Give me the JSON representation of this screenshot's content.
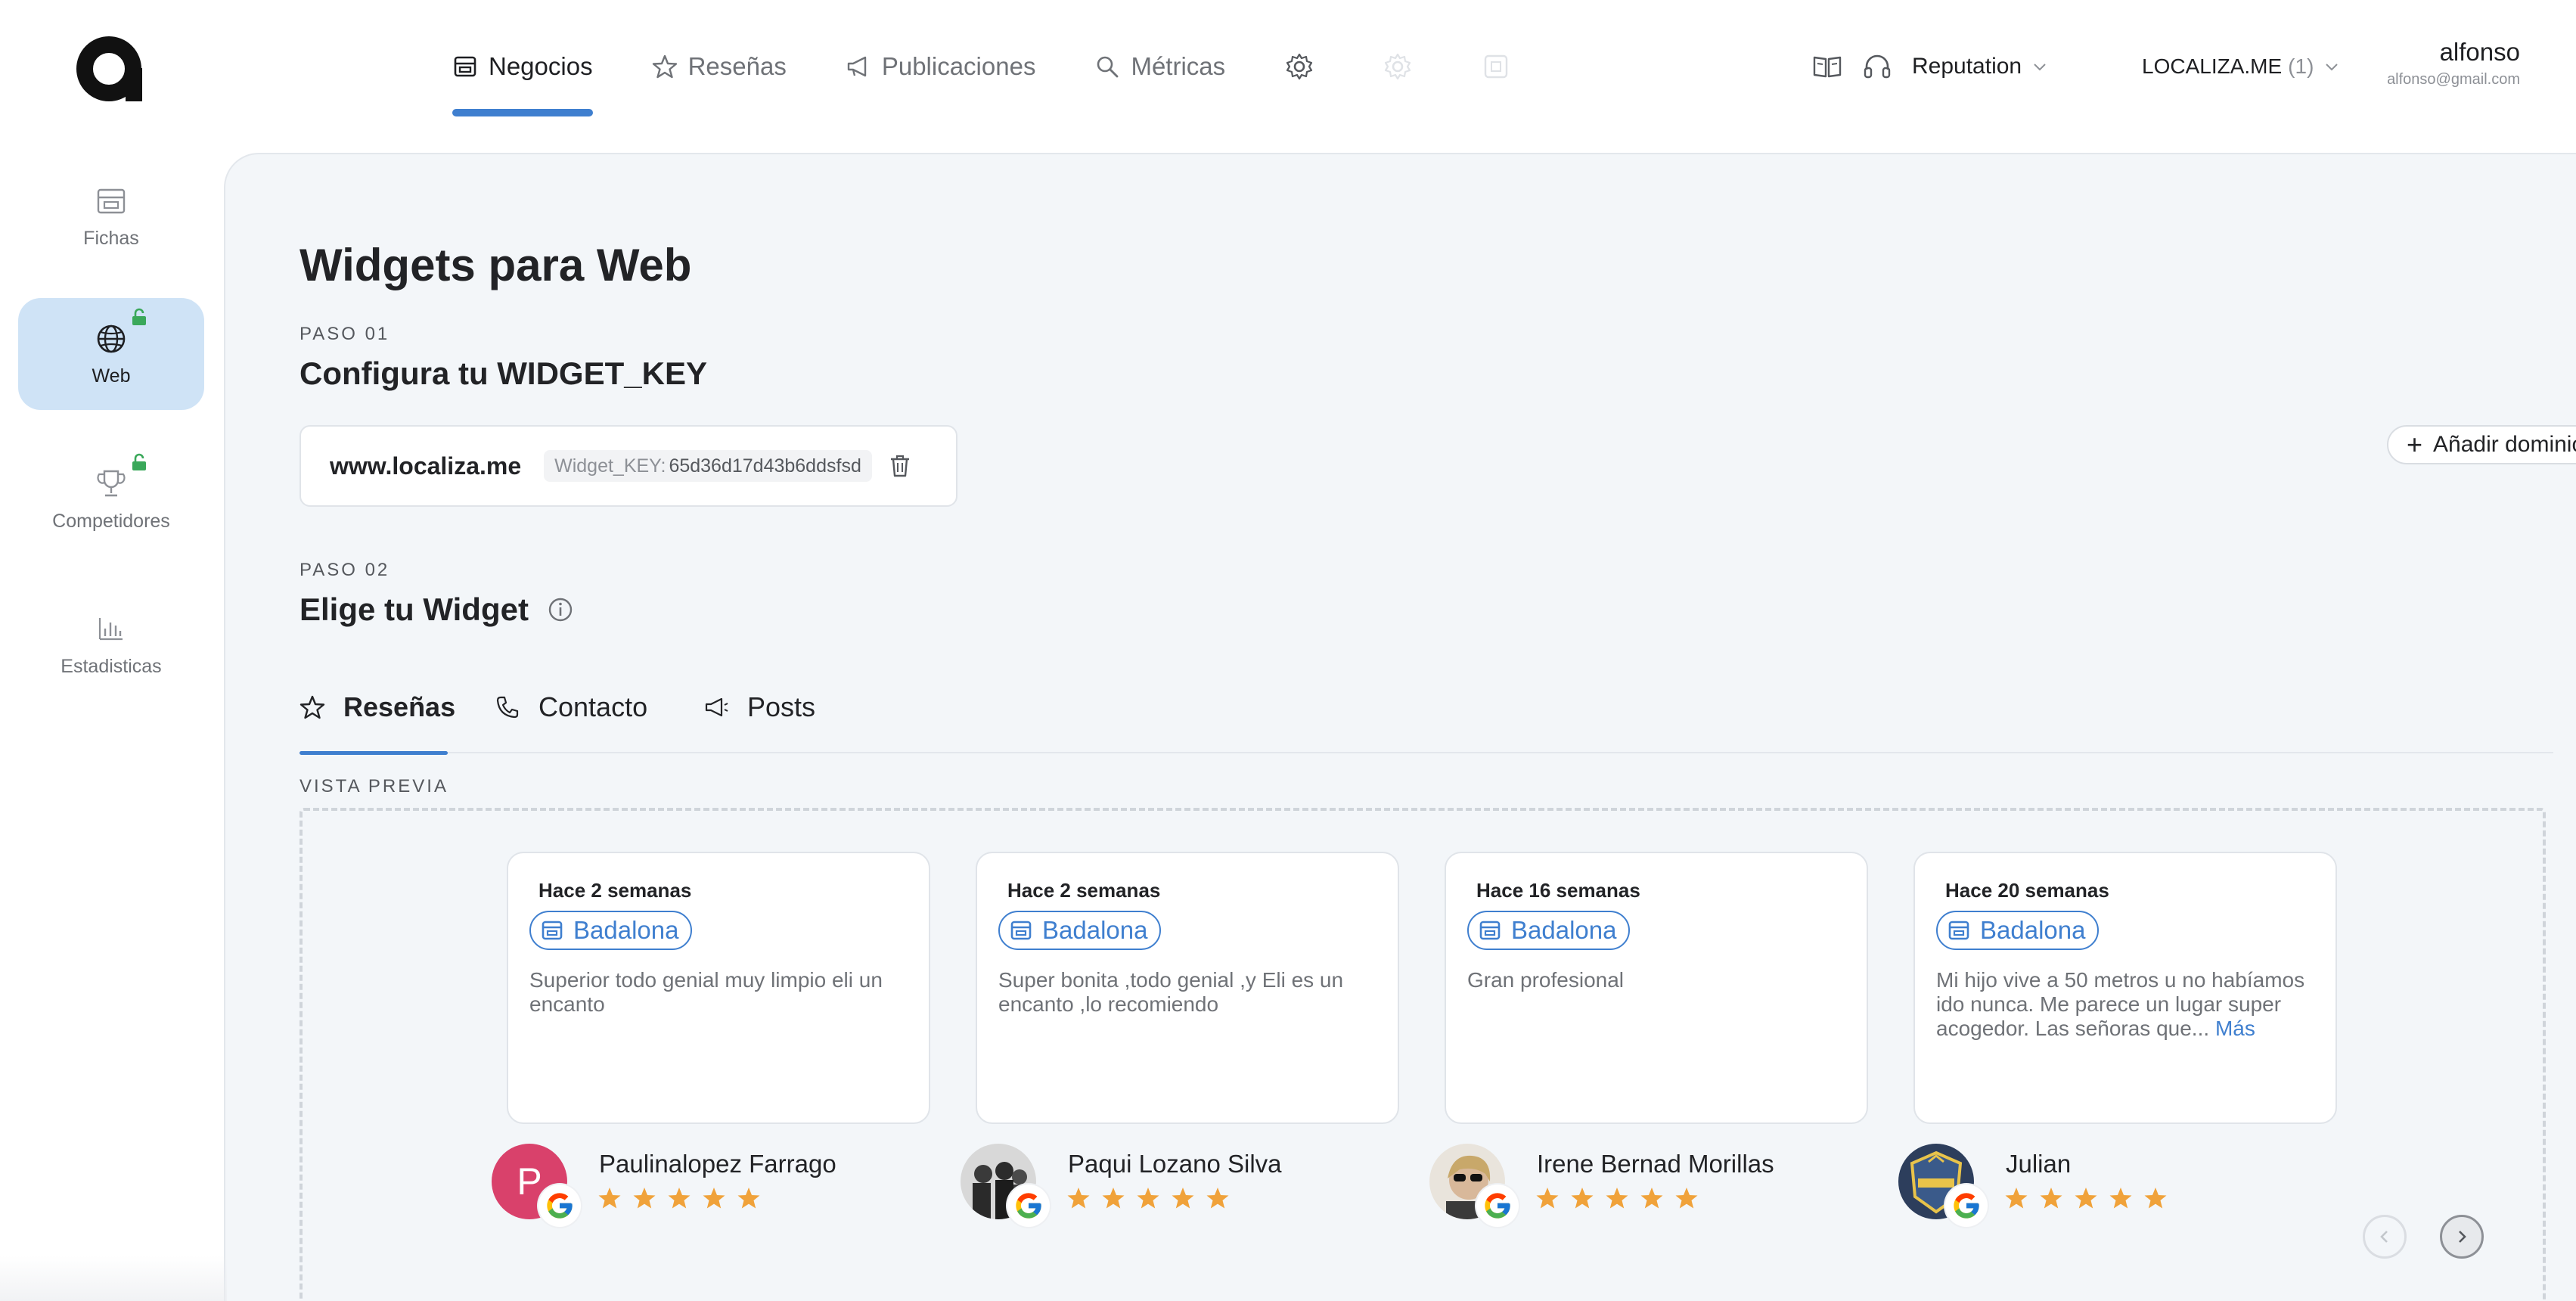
{
  "app": {
    "nav": [
      {
        "label": "Negocios",
        "icon": "store-icon",
        "active": true
      },
      {
        "label": "Reseñas",
        "icon": "star-outline-icon",
        "active": false
      },
      {
        "label": "Publicaciones",
        "icon": "megaphone-icon",
        "active": false
      },
      {
        "label": "Métricas",
        "icon": "search-icon",
        "active": false
      }
    ],
    "extra_nav_icons": [
      "gear-icon",
      "gear-faded-icon",
      "square-faded-icon"
    ],
    "topright": {
      "book_icon": "book-open-icon",
      "support_icon": "headset-icon",
      "product_label": "Reputation",
      "org_label": "LOCALIZA.ME",
      "org_count": "(1)",
      "user_name": "alfonso",
      "user_email": "alfonso@gmail.com"
    }
  },
  "sidebar": {
    "items": [
      {
        "label": "Fichas",
        "icon": "storefront-icon",
        "active": false,
        "locked": false
      },
      {
        "label": "Web",
        "icon": "globe-icon",
        "active": true,
        "locked": true
      },
      {
        "label": "Competidores",
        "icon": "trophy-icon",
        "active": false,
        "locked": true
      },
      {
        "label": "Estadisticas",
        "icon": "bar-chart-icon",
        "active": false,
        "locked": false
      }
    ]
  },
  "page": {
    "title": "Widgets para Web",
    "step1": {
      "label": "PASO 01",
      "title": "Configura tu WIDGET_KEY",
      "domain": "www.localiza.me",
      "key_label": "Widget_KEY:",
      "key_value": "65d36d17d43b6ddsfsd",
      "add_domain_label": "Añadir dominio"
    },
    "step2": {
      "label": "PASO 02",
      "title": "Elige tu Widget"
    },
    "widget_tabs": [
      {
        "label": "Reseñas",
        "icon": "star-outline-icon",
        "active": true
      },
      {
        "label": "Contacto",
        "icon": "phone-icon",
        "active": false
      },
      {
        "label": "Posts",
        "icon": "megaphone-icon",
        "active": false
      }
    ],
    "preview_label": "VISTA PREVIA",
    "reviews": [
      {
        "when": "Hace 2 semanas",
        "location": "Badalona",
        "text": "Superior todo genial muy limpio eli un encanto",
        "more": "",
        "author": "Paulinalopez Farrago",
        "avatar_letter": "P",
        "rating": 5
      },
      {
        "when": "Hace 2 semanas",
        "location": "Badalona",
        "text": "Super bonita ,todo genial ,y Eli es un encanto ,lo recomiendo",
        "more": "",
        "author": "Paqui Lozano Silva",
        "avatar_letter": "",
        "rating": 5
      },
      {
        "when": "Hace 16 semanas",
        "location": "Badalona",
        "text": "Gran profesional",
        "more": "",
        "author": "Irene Bernad Morillas",
        "avatar_letter": "",
        "rating": 5
      },
      {
        "when": "Hace 20 semanas",
        "location": "Badalona",
        "text": "Mi hijo vive a 50 metros u no habíamos ido nunca. Me parece un lugar super acogedor. Las señoras que...",
        "more": "Más",
        "author": "Julian",
        "avatar_letter": "",
        "rating": 5
      }
    ]
  },
  "colors": {
    "accent": "#3f7fcf",
    "star": "#f0a23a",
    "lock": "#3aa85a",
    "panel_bg": "#f3f6f9",
    "active_side_bg": "#cfe3f6",
    "avatar_p": "#d9416b"
  }
}
